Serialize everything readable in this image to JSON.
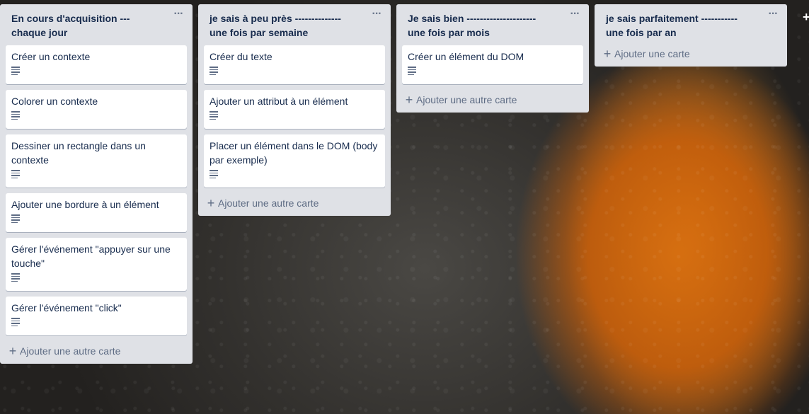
{
  "lists": [
    {
      "title_line1": "En cours d'acquisition ---",
      "title_line2": "chaque jour",
      "menu_icon": "ellipsis-icon",
      "cards": [
        {
          "title": "Créer un contexte"
        },
        {
          "title": "Colorer un contexte"
        },
        {
          "title": "Dessiner un rectangle dans un contexte"
        },
        {
          "title": "Ajouter une bordure à un élément"
        },
        {
          "title": "Gérer l'événement \"appuyer sur une touche\""
        },
        {
          "title": "Gérer l'événement \"click\""
        }
      ],
      "add_label": "Ajouter une autre carte"
    },
    {
      "title_line1": "je sais à peu près --------------",
      "title_line2": "une fois par semaine",
      "menu_icon": "ellipsis-icon",
      "cards": [
        {
          "title": "Créer du texte"
        },
        {
          "title": "Ajouter un attribut à un élément"
        },
        {
          "title": "Placer un élément dans le DOM (body par exemple)"
        }
      ],
      "add_label": "Ajouter une autre carte"
    },
    {
      "title_line1": "Je sais bien ---------------------",
      "title_line2": "une fois par mois",
      "menu_icon": "ellipsis-icon",
      "cards": [
        {
          "title": "Créer un élément du DOM"
        }
      ],
      "add_label": "Ajouter une autre carte"
    },
    {
      "title_line1": "je sais parfaitement -----------",
      "title_line2": "une fois par an",
      "menu_icon": "ellipsis-icon",
      "cards": [],
      "add_label": "Ajouter une carte"
    }
  ],
  "add_list_icon": "plus-icon",
  "colors": {
    "list_bg": "#dfe1e6",
    "card_bg": "#ffffff",
    "text": "#172b4d",
    "muted": "#5e6c84"
  }
}
